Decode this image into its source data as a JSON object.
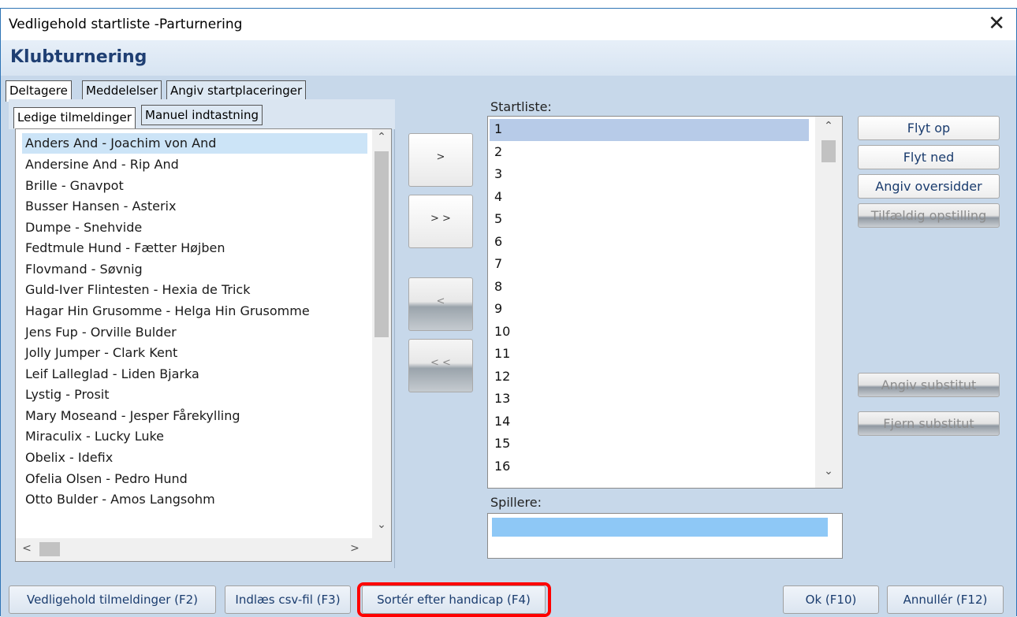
{
  "window": {
    "title": "Vedligehold startliste -Parturnering",
    "close_glyph": "✕"
  },
  "header": {
    "tournament_name": "Klubturnering"
  },
  "main_tabs": [
    {
      "label": "Deltagere",
      "active": true
    },
    {
      "label": "Meddelelser",
      "active": false
    },
    {
      "label": "Angiv startplaceringer",
      "active": false
    }
  ],
  "left_tabs": [
    {
      "label": "Ledige tilmeldinger",
      "active": true
    },
    {
      "label": "Manuel indtastning",
      "active": false
    }
  ],
  "available_entries": [
    "Anders And - Joachim von And",
    "Andersine And - Rip And",
    "Brille - Gnavpot",
    "Busser Hansen - Asterix",
    "Dumpe - Snehvide",
    "Fedtmule Hund - Fætter Højben",
    "Flovmand - Søvnig",
    "Guld-Iver Flintesten - Hexia de Trick",
    "Hagar Hin Grusomme - Helga Hin Grusomme",
    "Jens Fup - Orville Bulder",
    "Jolly Jumper - Clark Kent",
    "Leif Lalleglad - Liden Bjarka",
    "Lystig - Prosit",
    "Mary Moseand - Jesper Fårekylling",
    "Miraculix - Lucky Luke",
    "Obelix - Idefix",
    "Ofelia Olsen - Pedro Hund",
    "Otto Bulder - Amos Langsohm"
  ],
  "move_buttons": {
    "add_one": ">",
    "add_all": "> >",
    "remove_one": "<",
    "remove_all": "< <"
  },
  "startlist": {
    "label": "Startliste:",
    "positions": [
      "1",
      "2",
      "3",
      "4",
      "5",
      "6",
      "7",
      "8",
      "9",
      "10",
      "11",
      "12",
      "13",
      "14",
      "15",
      "16"
    ]
  },
  "players": {
    "label": "Spillere:"
  },
  "side_buttons": {
    "move_up": "Flyt op",
    "move_down": "Flyt ned",
    "set_bye": "Angiv oversidder",
    "random": "Tilfældig opstilling",
    "set_substitute": "Angiv substitut",
    "remove_substitute": "Fjern substitut"
  },
  "bottom_buttons": {
    "maintain": "Vedligehold tilmeldinger (F2)",
    "import_csv": "Indlæs csv-fil (F3)",
    "sort_handicap": "Sortér efter handicap (F4)",
    "ok": "Ok (F10)",
    "cancel": "Annullér (F12)"
  },
  "scroll_glyphs": {
    "up": "⌃",
    "down": "⌄",
    "left": "<",
    "right": ">"
  }
}
